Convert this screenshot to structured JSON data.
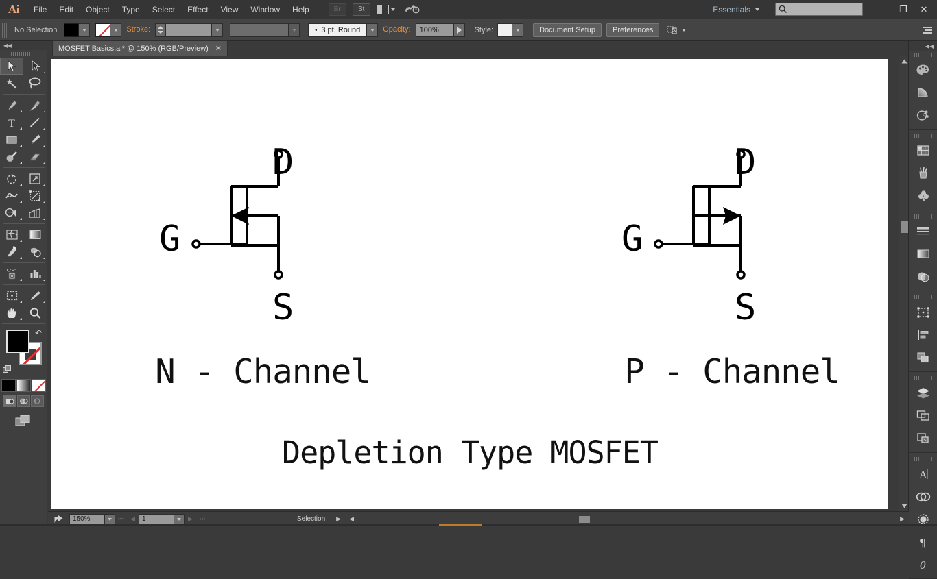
{
  "app": {
    "name": "Ai",
    "logo_text": "Ai"
  },
  "menubar": {
    "items": [
      "File",
      "Edit",
      "Object",
      "Type",
      "Select",
      "Effect",
      "View",
      "Window",
      "Help"
    ],
    "bridge_label": "Br",
    "stock_label": "St",
    "workspace_label": "Essentials",
    "search_placeholder": "",
    "window_minimize": "—",
    "window_restore": "❐",
    "window_close": "✕"
  },
  "controlbar": {
    "selection_status": "No Selection",
    "fill_color": "#000000",
    "stroke_color": "none",
    "stroke_label": "Stroke:",
    "stroke_weight": "",
    "stroke_profile": "",
    "brush_definition": "3 pt. Round",
    "opacity_label": "Opacity:",
    "opacity_value": "100%",
    "style_label": "Style:",
    "document_setup_label": "Document Setup",
    "preferences_label": "Preferences"
  },
  "tabs": {
    "documents": [
      {
        "title": "MOSFET Basics.ai* @ 150% (RGB/Preview)",
        "close": "✕",
        "active": true
      }
    ]
  },
  "toolbar": {
    "collapse_glyph": "◀◀",
    "tools": [
      {
        "name": "selection-tool",
        "glyph": "selection",
        "active": true
      },
      {
        "name": "direct-selection-tool",
        "glyph": "direct-selection"
      },
      {
        "name": "magic-wand-tool",
        "glyph": "magic-wand"
      },
      {
        "name": "lasso-tool",
        "glyph": "lasso"
      },
      {
        "name": "pen-tool",
        "glyph": "pen"
      },
      {
        "name": "curvature-tool",
        "glyph": "curvature"
      },
      {
        "name": "type-tool",
        "glyph": "type"
      },
      {
        "name": "line-segment-tool",
        "glyph": "line"
      },
      {
        "name": "rectangle-tool",
        "glyph": "rectangle"
      },
      {
        "name": "paintbrush-tool",
        "glyph": "paintbrush"
      },
      {
        "name": "shaper-tool",
        "glyph": "shaper"
      },
      {
        "name": "eraser-tool",
        "glyph": "eraser"
      },
      {
        "name": "rotate-tool",
        "glyph": "rotate"
      },
      {
        "name": "scale-tool",
        "glyph": "scale"
      },
      {
        "name": "width-tool",
        "glyph": "width"
      },
      {
        "name": "free-transform-tool",
        "glyph": "free-transform"
      },
      {
        "name": "shape-builder-tool",
        "glyph": "shape-builder"
      },
      {
        "name": "perspective-grid-tool",
        "glyph": "perspective-grid"
      },
      {
        "name": "mesh-tool",
        "glyph": "mesh"
      },
      {
        "name": "gradient-tool",
        "glyph": "gradient"
      },
      {
        "name": "eyedropper-tool",
        "glyph": "eyedropper"
      },
      {
        "name": "blend-tool",
        "glyph": "blend"
      },
      {
        "name": "symbol-sprayer-tool",
        "glyph": "symbol-sprayer"
      },
      {
        "name": "column-graph-tool",
        "glyph": "column-graph"
      },
      {
        "name": "artboard-tool",
        "glyph": "artboard"
      },
      {
        "name": "slice-tool",
        "glyph": "slice"
      },
      {
        "name": "hand-tool",
        "glyph": "hand"
      },
      {
        "name": "zoom-tool",
        "glyph": "zoom"
      }
    ],
    "fill_swatch": "#000000",
    "stroke_swatch": "#ffffff",
    "color_modes": [
      "color",
      "gradient",
      "none"
    ],
    "draw_modes": [
      "draw-normal",
      "draw-behind",
      "draw-inside"
    ],
    "screen_mode": "change-screen-mode"
  },
  "right_dock": {
    "collapse_glyph": "◀◀",
    "groups": [
      [
        "color-panel",
        "color-guide-panel",
        "kuler-panel"
      ],
      [
        "swatches-panel",
        "brushes-panel",
        "symbols-panel"
      ],
      [
        "stroke-panel",
        "gradient-panel",
        "transparency-panel"
      ],
      [
        "transform-panel",
        "align-panel",
        "pathfinder-panel"
      ],
      [
        "layers-panel",
        "artboards-panel",
        "links-panel"
      ],
      [
        "character-panel",
        "graphic-styles-panel",
        "appearance-panel",
        "paragraph-panel",
        "opacity-panel"
      ]
    ]
  },
  "canvas": {
    "background": "#ffffff",
    "zoom": "150%"
  },
  "diagram": {
    "title": "Depletion Type MOSFET",
    "symbols": [
      {
        "caption": "N - Channel",
        "terminals": {
          "drain": "D",
          "gate": "G",
          "source": "S"
        },
        "arrow_direction": "left-pointing-inward",
        "channel_type": "N"
      },
      {
        "caption": "P - Channel",
        "terminals": {
          "drain": "D",
          "gate": "G",
          "source": "S"
        },
        "arrow_direction": "right-pointing-outward",
        "channel_type": "P"
      }
    ],
    "stroke_color": "#000000"
  },
  "statusbar": {
    "zoom_value": "150%",
    "page_value": "1",
    "status_text": "Selection",
    "first_page_glyph": "⏮",
    "prev_page_glyph": "◀",
    "next_page_glyph": "▶",
    "last_page_glyph": "⏭",
    "expand_glyph": "▶",
    "artboard_nav_glyph": "◀"
  }
}
